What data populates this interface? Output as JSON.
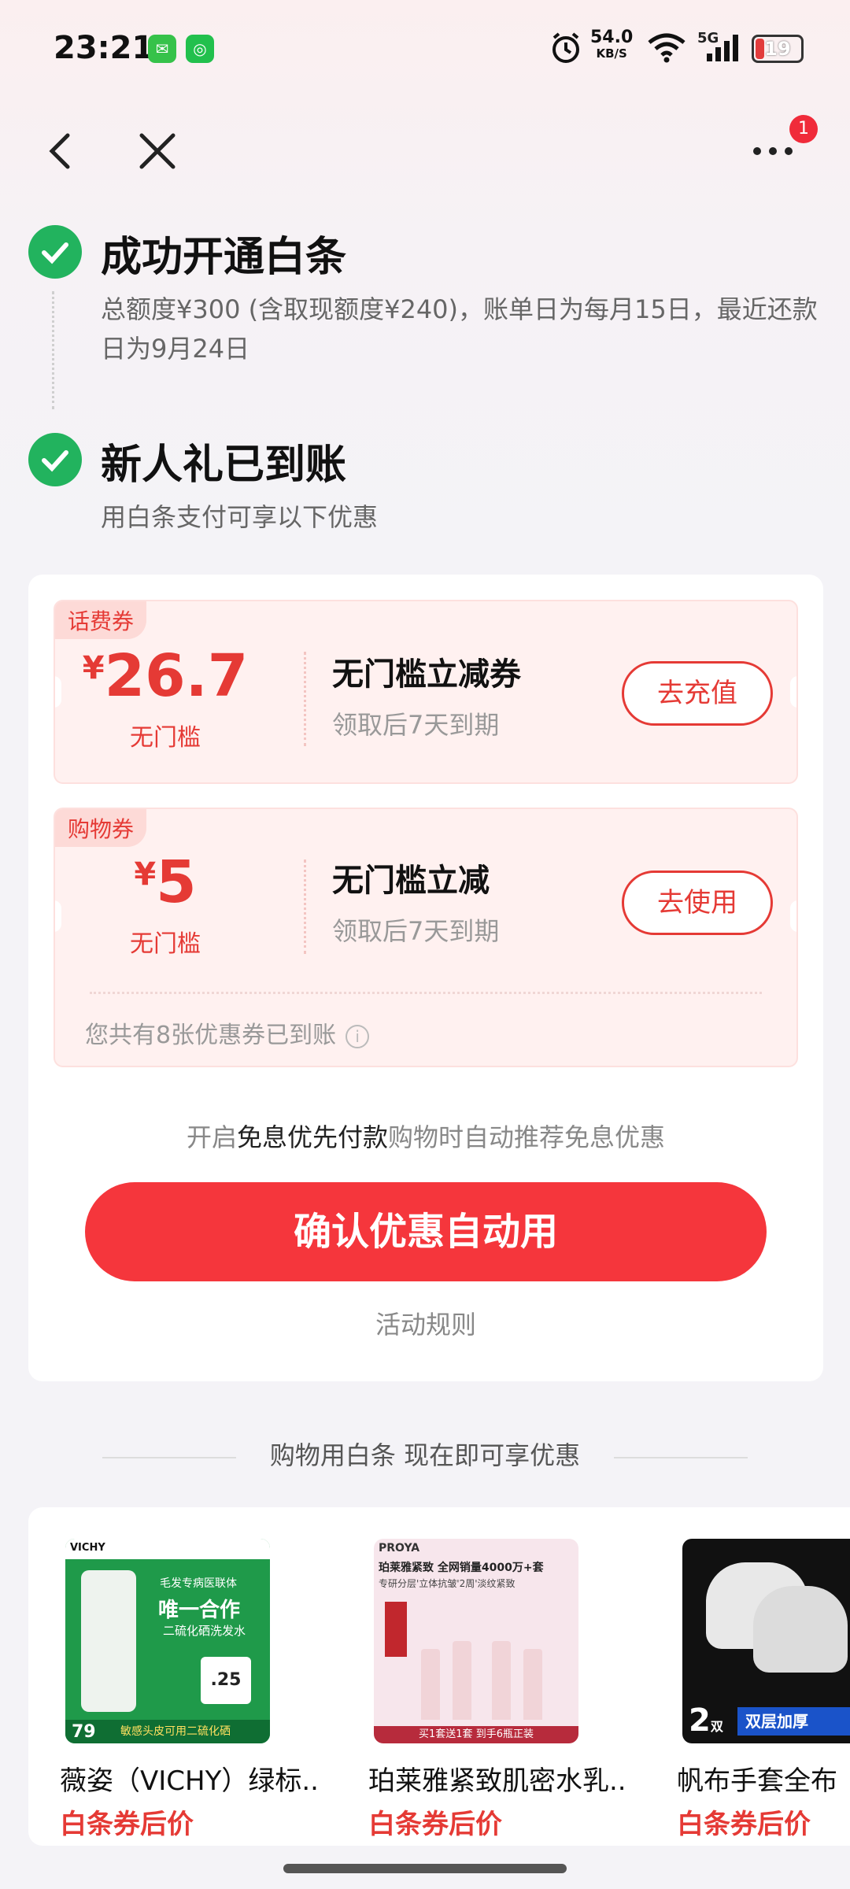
{
  "status_bar": {
    "time": "23:21",
    "net_speed": "54.0",
    "net_unit": "KB/S",
    "signal": "5G",
    "battery": "19"
  },
  "nav": {
    "badge": "1"
  },
  "steps": [
    {
      "title": "成功开通白条",
      "desc": "总额度¥300 (含取现额度¥240)，账单日为每月15日，最近还款日为9月24日"
    },
    {
      "title": "新人礼已到账",
      "desc": "用白条支付可享以下优惠"
    }
  ],
  "coupons": [
    {
      "tag": "话费券",
      "currency": "¥",
      "amount": "26.7",
      "condition": "无门槛",
      "name": "无门槛立减券",
      "expire": "领取后7天到期",
      "button": "去充值"
    },
    {
      "tag": "购物券",
      "currency": "¥",
      "amount": "5",
      "condition": "无门槛",
      "name": "无门槛立减",
      "expire": "领取后7天到期",
      "button": "去使用"
    }
  ],
  "summary": "您共有8张优惠券已到账",
  "tip": {
    "prefix": "开启",
    "highlight": "免息优先付款",
    "suffix": "购物时自动推荐免息优惠"
  },
  "confirm_button": "确认优惠自动用",
  "rules_link": "活动规则",
  "section_title": "购物用白条 现在即可享优惠",
  "products": [
    {
      "name": "薇姿（VICHY）绿标...",
      "price_label": "白条券后价",
      "image_text": {
        "brand": "VICHY",
        "title": "唯一合作",
        "line1": "毛发专病医联体",
        "line2": "二硫化硒洗发水",
        "price": "79",
        "coupon": ".25",
        "bottom": "敏感头皮可用二硫化硒"
      }
    },
    {
      "name": "珀莱雅紧致肌密水乳...",
      "price_label": "白条券后价",
      "image_text": {
        "brand": "PROYA",
        "title": "珀莱雅紧致 全网销量4000万+套",
        "line1": "专研分层'立体抗皱'2周'淡纹紧致",
        "bottom": "买1套送1套 到手6瓶正装"
      }
    },
    {
      "name": "帆布手套全布",
      "price_label": "白条券后价",
      "image_text": {
        "count": "2",
        "unit": "双",
        "label": "双层加厚"
      }
    }
  ],
  "colors": {
    "accent": "#f5363c",
    "success": "#22b35e",
    "coupon_bg": "#fff1f0"
  }
}
